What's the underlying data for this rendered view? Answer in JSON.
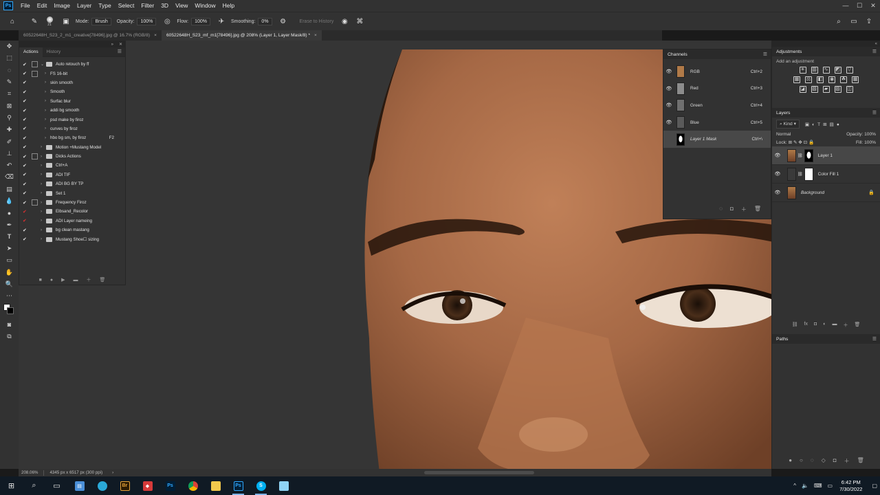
{
  "menubar": {
    "logo": "Ps",
    "items": [
      "File",
      "Edit",
      "Image",
      "Layer",
      "Type",
      "Select",
      "Filter",
      "3D",
      "View",
      "Window",
      "Help"
    ],
    "window_controls": [
      "—",
      "☐",
      "✕"
    ]
  },
  "options": {
    "brush_size": "21",
    "mode_label": "Mode:",
    "mode_value": "Brush",
    "opacity_label": "Opacity:",
    "opacity_value": "100%",
    "flow_label": "Flow:",
    "flow_value": "100%",
    "smoothing_label": "Smoothing:",
    "smoothing_value": "0%",
    "erase_history": "Erase to History"
  },
  "tabs": [
    {
      "label": "60522648H_S23_2_m1_creative[78496].jpg @ 16.7% (RGB/8)",
      "close": "×"
    },
    {
      "label": "60522648H_S23_mf_m1[78496].jpg @ 208% (Layer 1, Layer Mask/8) *",
      "close": "×"
    }
  ],
  "actions_panel": {
    "tab_actions": "Actions",
    "tab_history": "History",
    "rows": [
      {
        "label": "Auto retouch by ff",
        "check": "✔",
        "dialog": "☐",
        "expanded": true,
        "folder": true,
        "indent": 0,
        "key": ""
      },
      {
        "label": "FS 16-bit",
        "check": "✔",
        "dialog": "☐",
        "expanded": false,
        "folder": false,
        "indent": 1,
        "key": ""
      },
      {
        "label": "skin smooth",
        "check": "✔",
        "dialog": "",
        "expanded": false,
        "folder": false,
        "indent": 1,
        "key": ""
      },
      {
        "label": "Smooth",
        "check": "✔",
        "dialog": "",
        "expanded": false,
        "folder": false,
        "indent": 1,
        "key": ""
      },
      {
        "label": "Surfac blur",
        "check": "✔",
        "dialog": "",
        "expanded": false,
        "folder": false,
        "indent": 1,
        "key": ""
      },
      {
        "label": "addi bg smooth",
        "check": "✔",
        "dialog": "",
        "expanded": false,
        "folder": false,
        "indent": 1,
        "key": ""
      },
      {
        "label": "psd make by firoz",
        "check": "✔",
        "dialog": "",
        "expanded": false,
        "folder": false,
        "indent": 1,
        "key": ""
      },
      {
        "label": "curves by firoz",
        "check": "✔",
        "dialog": "",
        "expanded": false,
        "folder": false,
        "indent": 1,
        "key": ""
      },
      {
        "label": "hbo bg sm, by firoz",
        "check": "✔",
        "dialog": "",
        "expanded": false,
        "folder": false,
        "indent": 1,
        "key": "F2"
      },
      {
        "label": "Motion +Mustang Model",
        "check": "✔",
        "dialog": "",
        "expanded": false,
        "folder": true,
        "indent": 0,
        "key": ""
      },
      {
        "label": "Dicks Actions",
        "check": "✔",
        "dialog": "☐",
        "expanded": false,
        "folder": true,
        "indent": 0,
        "key": ""
      },
      {
        "label": "Ctrl+A",
        "check": "✔",
        "dialog": "",
        "expanded": false,
        "folder": true,
        "indent": 0,
        "key": ""
      },
      {
        "label": "ADI TIF",
        "check": "✔",
        "dialog": "",
        "expanded": false,
        "folder": true,
        "indent": 0,
        "key": ""
      },
      {
        "label": "ADI BG BY TP",
        "check": "✔",
        "dialog": "",
        "expanded": false,
        "folder": true,
        "indent": 0,
        "key": ""
      },
      {
        "label": "Set 1",
        "check": "✔",
        "dialog": "",
        "expanded": false,
        "folder": true,
        "indent": 0,
        "key": ""
      },
      {
        "label": "Frequency Firoz",
        "check": "✔",
        "dialog": "☐",
        "expanded": false,
        "folder": true,
        "indent": 0,
        "key": ""
      },
      {
        "label": "Elbsand_Recolor",
        "check": "✔",
        "dialog": "",
        "expanded": false,
        "folder": true,
        "indent": 0,
        "key": "",
        "red": true
      },
      {
        "label": "ADI Layer nameing",
        "check": "✔",
        "dialog": "",
        "expanded": false,
        "folder": true,
        "indent": 0,
        "key": "",
        "red": true
      },
      {
        "label": "bg clean mastang",
        "check": "✔",
        "dialog": "",
        "expanded": false,
        "folder": true,
        "indent": 0,
        "key": ""
      },
      {
        "label": "Mustang Shoe☐ sizing",
        "check": "✔",
        "dialog": "",
        "expanded": false,
        "folder": true,
        "indent": 0,
        "key": ""
      }
    ],
    "footer_icons": [
      "■",
      "●",
      "▶",
      "▬",
      "＋",
      "🗑"
    ]
  },
  "channels_panel": {
    "title": "Channels",
    "rows": [
      {
        "label": "RGB",
        "key": "Ctrl+2",
        "visible": true,
        "thumb": "#b07a48",
        "italic": false
      },
      {
        "label": "Red",
        "key": "Ctrl+3",
        "visible": true,
        "thumb": "#8c8c8c",
        "italic": false
      },
      {
        "label": "Green",
        "key": "Ctrl+4",
        "visible": true,
        "thumb": "#6f6f6f",
        "italic": false
      },
      {
        "label": "Blue",
        "key": "Ctrl+5",
        "visible": true,
        "thumb": "#5a5a5a",
        "italic": false
      },
      {
        "label": "Layer 1 Mask",
        "key": "Ctrl+\\",
        "visible": false,
        "thumb": "#000000",
        "italic": true,
        "selected": true
      }
    ]
  },
  "adjustments": {
    "title": "Adjustments",
    "subtitle": "Add an adjustment"
  },
  "layers": {
    "title": "Layers",
    "kind": "Kind",
    "blend": "Normal",
    "opacity_label": "Opacity:",
    "opacity_value": "100%",
    "lock_label": "Lock:",
    "fill_label": "Fill:",
    "fill_value": "100%",
    "rows": [
      {
        "label": "Layer 1",
        "selected": true,
        "italic": false,
        "lock": false
      },
      {
        "label": "Color Fill 1",
        "selected": false,
        "italic": false,
        "lock": false
      },
      {
        "label": "Background",
        "selected": false,
        "italic": true,
        "lock": true
      }
    ]
  },
  "paths": {
    "title": "Paths"
  },
  "status": {
    "zoom": "208.06%",
    "doc_info": "4345 px x 6517 px (300 ppi)"
  },
  "taskbar": {
    "time": "6:42 PM",
    "date": "7/30/2022"
  }
}
